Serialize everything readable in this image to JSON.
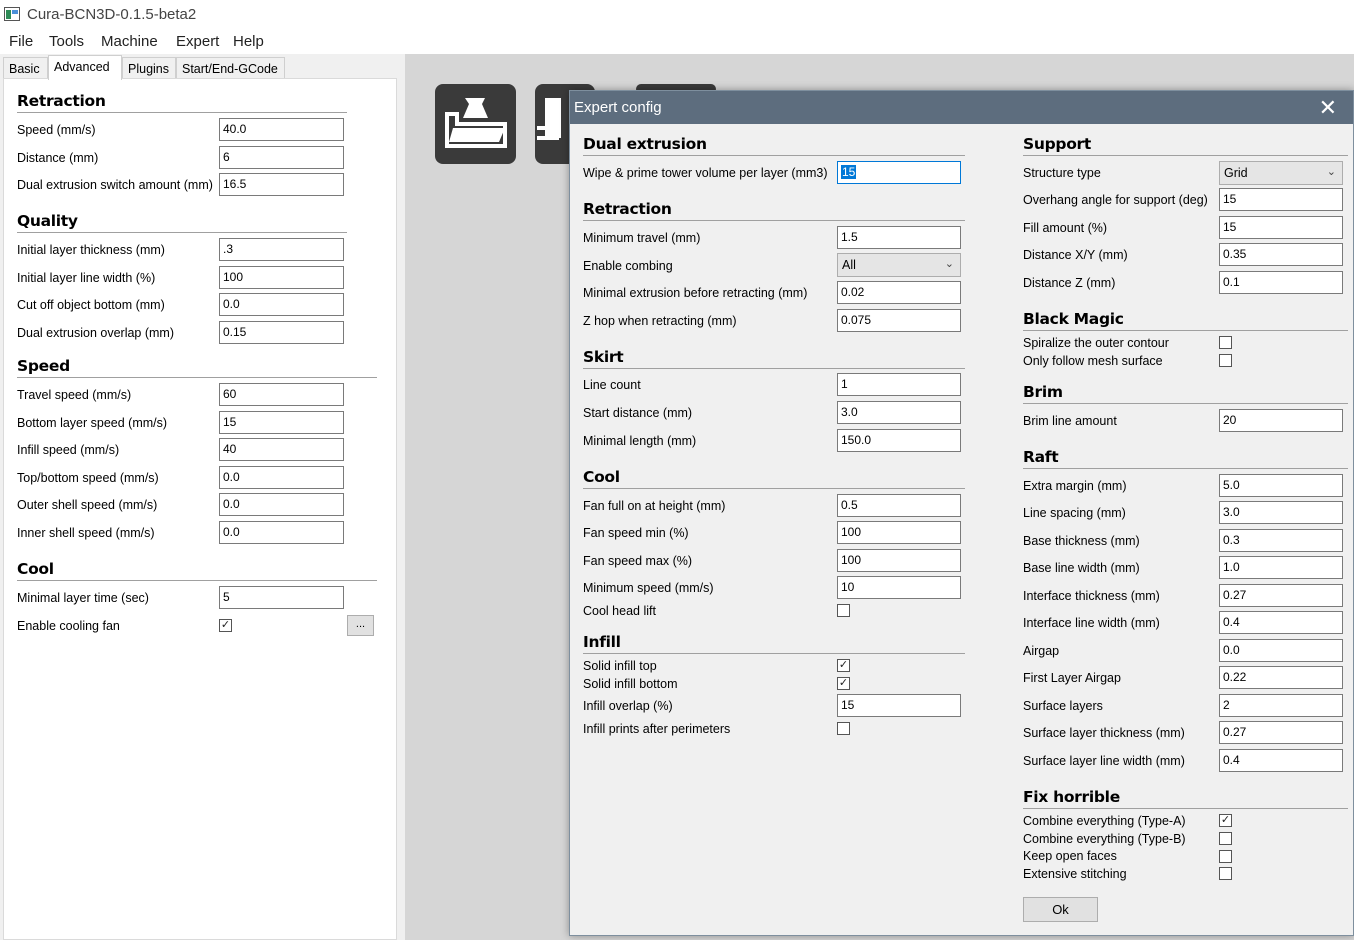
{
  "window": {
    "title": "Cura-BCN3D-0.1.5-beta2"
  },
  "menu": [
    "File",
    "Tools",
    "Machine",
    "Expert",
    "Help"
  ],
  "tabs": [
    "Basic",
    "Advanced",
    "Plugins",
    "Start/End-GCode"
  ],
  "left": {
    "retraction": {
      "title": "Retraction",
      "fields": [
        {
          "label": "Speed (mm/s)",
          "value": "40.0"
        },
        {
          "label": "Distance (mm)",
          "value": "6"
        },
        {
          "label": "Dual extrusion switch amount (mm)",
          "value": "16.5"
        }
      ]
    },
    "quality": {
      "title": "Quality",
      "fields": [
        {
          "label": "Initial layer thickness (mm)",
          "value": ".3"
        },
        {
          "label": "Initial layer line width (%)",
          "value": "100"
        },
        {
          "label": "Cut off object bottom (mm)",
          "value": "0.0"
        },
        {
          "label": "Dual extrusion overlap (mm)",
          "value": "0.15"
        }
      ]
    },
    "speed": {
      "title": "Speed",
      "fields": [
        {
          "label": "Travel speed (mm/s)",
          "value": "60"
        },
        {
          "label": "Bottom layer speed (mm/s)",
          "value": "15"
        },
        {
          "label": "Infill speed (mm/s)",
          "value": "40"
        },
        {
          "label": "Top/bottom speed (mm/s)",
          "value": "0.0"
        },
        {
          "label": "Outer shell speed (mm/s)",
          "value": "0.0"
        },
        {
          "label": "Inner shell speed (mm/s)",
          "value": "0.0"
        }
      ]
    },
    "cool": {
      "title": "Cool",
      "min_layer_time_label": "Minimal layer time (sec)",
      "min_layer_time": "5",
      "fan_label": "Enable cooling fan",
      "fan_checked": true,
      "more_button": "..."
    }
  },
  "dialog": {
    "title": "Expert config",
    "close": "✕",
    "dual": {
      "title": "Dual extrusion",
      "label": "Wipe & prime tower volume per layer (mm3)",
      "value": "15"
    },
    "retraction": {
      "title": "Retraction",
      "min_travel_label": "Minimum travel (mm)",
      "min_travel": "1.5",
      "combing_label": "Enable combing",
      "combing": "All",
      "min_extrusion_label": "Minimal extrusion before retracting (mm)",
      "min_extrusion": "0.02",
      "zhop_label": "Z hop when retracting (mm)",
      "zhop": "0.075"
    },
    "skirt": {
      "title": "Skirt",
      "fields": [
        {
          "label": "Line count",
          "value": "1"
        },
        {
          "label": "Start distance (mm)",
          "value": "3.0"
        },
        {
          "label": "Minimal length (mm)",
          "value": "150.0"
        }
      ]
    },
    "cool": {
      "title": "Cool",
      "fields": [
        {
          "label": "Fan full on at height (mm)",
          "value": "0.5"
        },
        {
          "label": "Fan speed min (%)",
          "value": "100"
        },
        {
          "label": "Fan speed max (%)",
          "value": "100"
        },
        {
          "label": "Minimum speed (mm/s)",
          "value": "10"
        }
      ],
      "head_lift_label": "Cool head lift",
      "head_lift": false
    },
    "infill": {
      "title": "Infill",
      "solid_top_label": "Solid infill top",
      "solid_top": true,
      "solid_bottom_label": "Solid infill bottom",
      "solid_bottom": true,
      "overlap_label": "Infill overlap (%)",
      "overlap": "15",
      "after_perimeters_label": "Infill prints after perimeters",
      "after_perimeters": false
    },
    "support": {
      "title": "Support",
      "structure_label": "Structure type",
      "structure": "Grid",
      "fields": [
        {
          "label": "Overhang angle for support (deg)",
          "value": "15"
        },
        {
          "label": "Fill amount (%)",
          "value": "15"
        },
        {
          "label": "Distance X/Y (mm)",
          "value": "0.35"
        },
        {
          "label": "Distance Z (mm)",
          "value": "0.1"
        }
      ]
    },
    "black_magic": {
      "title": "Black Magic",
      "spiralize_label": "Spiralize the outer contour",
      "spiralize": false,
      "mesh_surface_label": "Only follow mesh surface",
      "mesh_surface": false
    },
    "brim": {
      "title": "Brim",
      "label": "Brim line amount",
      "value": "20"
    },
    "raft": {
      "title": "Raft",
      "fields": [
        {
          "label": "Extra margin (mm)",
          "value": "5.0"
        },
        {
          "label": "Line spacing (mm)",
          "value": "3.0"
        },
        {
          "label": "Base thickness (mm)",
          "value": "0.3"
        },
        {
          "label": "Base line width (mm)",
          "value": "1.0"
        },
        {
          "label": "Interface thickness (mm)",
          "value": "0.27"
        },
        {
          "label": "Interface line width (mm)",
          "value": "0.4"
        },
        {
          "label": "Airgap",
          "value": "0.0"
        },
        {
          "label": "First Layer Airgap",
          "value": "0.22"
        },
        {
          "label": "Surface layers",
          "value": "2"
        },
        {
          "label": "Surface layer thickness (mm)",
          "value": "0.27"
        },
        {
          "label": "Surface layer line width (mm)",
          "value": "0.4"
        }
      ]
    },
    "fix": {
      "title": "Fix horrible",
      "items": [
        {
          "label": "Combine everything (Type-A)",
          "checked": true
        },
        {
          "label": "Combine everything (Type-B)",
          "checked": false
        },
        {
          "label": "Keep open faces",
          "checked": false
        },
        {
          "label": "Extensive stitching",
          "checked": false
        }
      ]
    },
    "ok": "Ok"
  },
  "colors": {
    "dialog_title_bg": "#5d6d7e",
    "selection": "#0078d7",
    "tool_button": "#3a3a3a"
  }
}
